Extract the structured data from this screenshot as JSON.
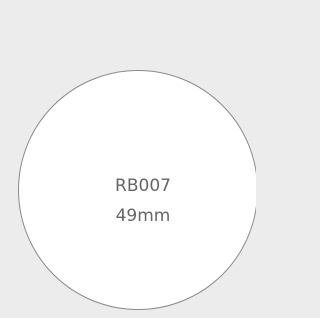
{
  "label": {
    "code": "RB007",
    "size": "49mm"
  },
  "colors": {
    "background": "#ececec",
    "circle_fill": "#ffffff",
    "circle_outline": "#8a8a8a",
    "text": "#666666"
  }
}
